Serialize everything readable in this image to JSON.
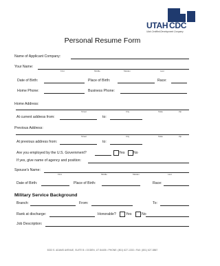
{
  "logo": {
    "utah": "UTAH",
    "cdc": "CDC",
    "tagline": "Utah Certified Development Company"
  },
  "title": "Personal Resume Form",
  "fields": {
    "applicant_company": "Name of Applicant Company:",
    "your_name": "Your Name:",
    "name_parts": [
      "First",
      "Middle",
      "Maiden",
      "Last"
    ],
    "dob": "Date of Birth:",
    "place_of_birth": "Place of Birth:",
    "race": "Race:",
    "home_phone": "Home Phone:",
    "business_phone": "Business Phone:",
    "home_address": "Home Address:",
    "address_parts": [
      "Street",
      "City",
      "State",
      "Zip"
    ],
    "at_current_address_from": "At current address from:",
    "to": "to:",
    "previous_address": "Previous Address:",
    "previous_address_parts": [
      "Street",
      "City",
      "State",
      "Zip"
    ],
    "at_previous_address_from": "At previous address from:",
    "to2": "to:",
    "employed_question": "Are you employed by the U.S. Government?",
    "yes": "Yes",
    "no": "No",
    "agency_position": "If yes, give name of agency and position:",
    "spouse_name": "Spouse's Name:",
    "spouse_name_parts": [
      "First",
      "Middle",
      "Maiden",
      "Last"
    ],
    "spouse_dob": "Date of Birth:",
    "spouse_place_of_birth": "Place of Birth:",
    "spouse_race": "Race:"
  },
  "military": {
    "heading": "Military Service Background",
    "branch": "Branch:",
    "from": "From:",
    "to": "To:",
    "rank": "Rank at discharge:",
    "honorable": "Honorable?",
    "yes": "Yes",
    "no": "No",
    "job_description": "Job Description:"
  },
  "footer": "5333 S. ADAMS AVENUE, SUITE B • OGDEN, UT 84405 • PHONE: (801) 627-1333 • FAX: (801) 627-8867"
}
